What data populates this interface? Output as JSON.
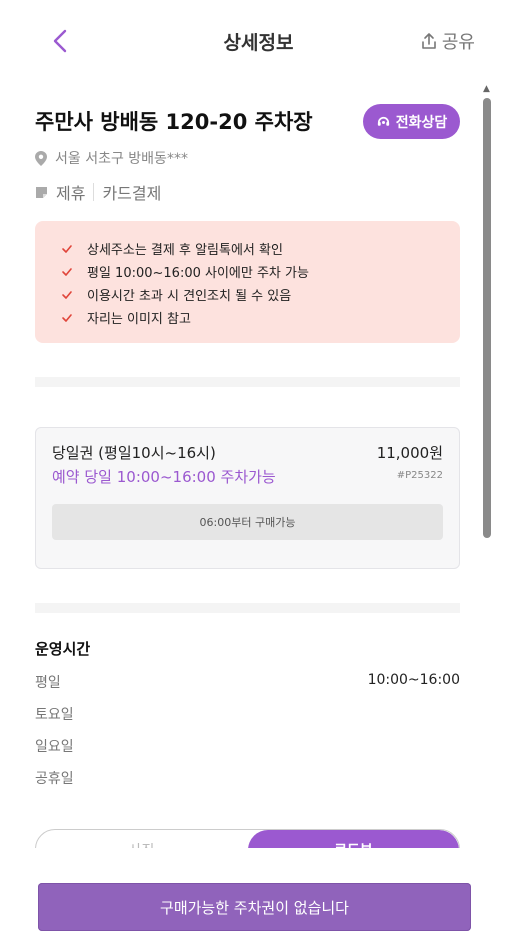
{
  "header": {
    "title": "상세정보",
    "share_label": "공유"
  },
  "lot": {
    "name": "주만사 방배동 120-20 주차장",
    "call_label": "전화상담",
    "address": "서울 서초구 방배동***",
    "tags": [
      "제휴",
      "카드결제"
    ]
  },
  "notices": [
    "상세주소는 결제 후 알림톡에서 확인",
    "평일 10:00~16:00 사이에만 주차 가능",
    "이용시간 초과 시 견인조치 될 수 있음",
    "자리는 이미지 참고"
  ],
  "ticket": {
    "name": "당일권 (평일10시~16시)",
    "price": "11,000원",
    "time": "예약 당일 10:00~16:00 주차가능",
    "code": "#P25322",
    "buy_label": "06:00부터 구매가능"
  },
  "hours": {
    "title": "운영시간",
    "rows": [
      {
        "day": "평일",
        "time": "10:00~16:00"
      },
      {
        "day": "토요일",
        "time": ""
      },
      {
        "day": "일요일",
        "time": ""
      },
      {
        "day": "공휴일",
        "time": ""
      }
    ]
  },
  "segment": {
    "left_label": "사진",
    "right_label": "로드뷰"
  },
  "cta": {
    "label": "구매가능한 주차권이 없습니다"
  },
  "colors": {
    "accent": "#9b59d0",
    "notice_bg": "#fde2de",
    "check": "#e0453a",
    "cta": "#9063bb"
  }
}
